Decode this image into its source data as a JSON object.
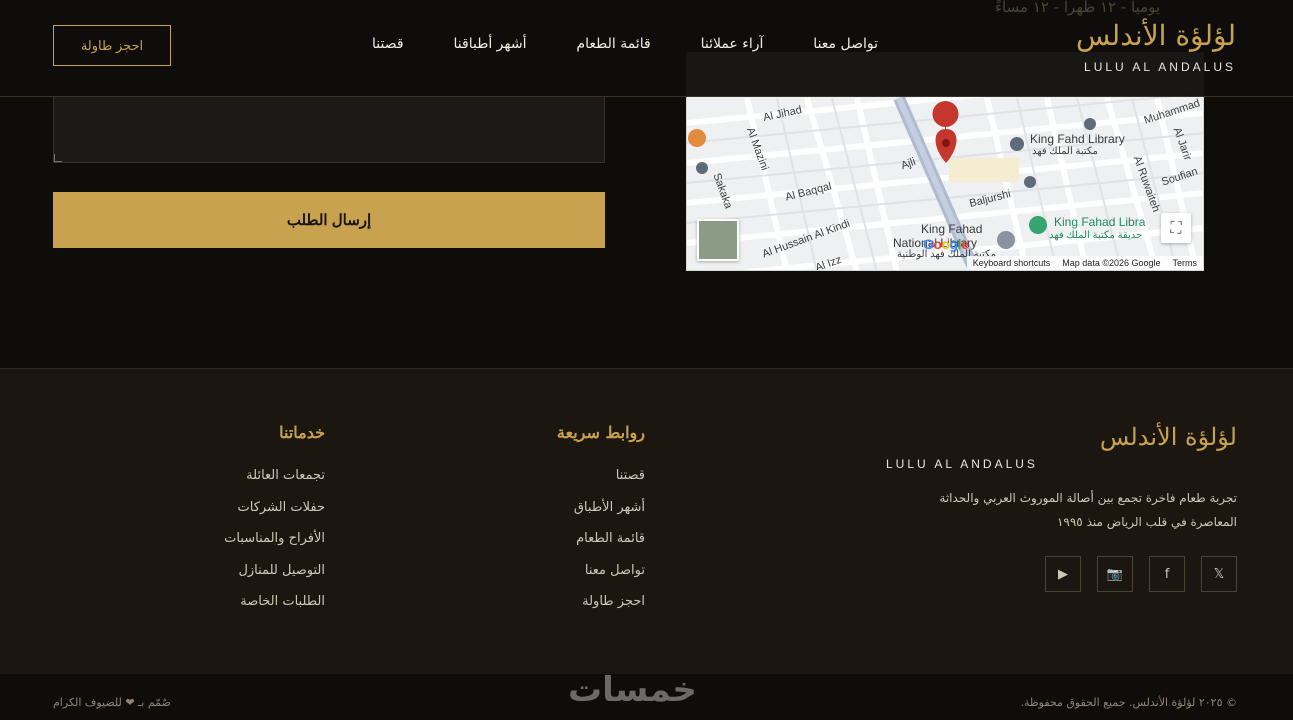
{
  "header": {
    "brand_ar": "لؤلؤة الأندلس",
    "brand_en": "LULU AL ANDALUS",
    "nav": [
      "قصتنا",
      "أشهر أطباقنا",
      "قائمة الطعام",
      "آراء عملائنا",
      "تواصل معنا"
    ],
    "reserve": "احجز طاولة",
    "ghost_text": "يومياً - ١٢ ظهراً - ١٢ مساءً"
  },
  "contact": {
    "send": "إرسال الطلب"
  },
  "map": {
    "labels": {
      "al_jihad": "Al Jihad",
      "al_mazini": "Al Mazini",
      "sakaka": "Sakaka",
      "al_baqqal": "Al Baqqal",
      "al_hussain": "Al Hussain Al Kindi",
      "ajli": "Ajli",
      "baljurshi": "Baljurshi",
      "king_fahd_library": "King Fahd Library",
      "king_fahd_library_ar": "مكتبة الملك فهد",
      "king_fahad_libra": "King Fahad Libra",
      "park_ar": "حديقة مكتبة الملك فهد",
      "king_fahad": "King Fahad",
      "national_library": "National Library",
      "national_ar": "مكتبة الملك فهد الوطنية",
      "al_ruwaiteh": "Al Ruwaiteh",
      "soufian": "Soufian",
      "al_jarir": "Al Jarir",
      "muhammad": "Muhammad",
      "al_izz": "Al Izz"
    },
    "footer": [
      "Keyboard shortcuts",
      "Map data ©2026 Google",
      "Terms"
    ],
    "google": "Google"
  },
  "footer": {
    "brand_ar": "لؤلؤة الأندلس",
    "brand_en": "LULU AL ANDALUS",
    "desc": "تجربة طعام فاخرة تجمع بين أصالة الموروث العربي والحداثة المعاصرة في قلب الرياض منذ ١٩٩٥",
    "socials": [
      "𝕏",
      "f",
      "📷",
      "▶"
    ],
    "links_title": "روابط سريعة",
    "links": [
      "قصتنا",
      "أشهر الأطباق",
      "قائمة الطعام",
      "تواصل معنا",
      "احجز طاولة"
    ],
    "services_title": "خدماتنا",
    "services": [
      "تجمعات العائلة",
      "حفلات الشركات",
      "الأفراح والمناسبات",
      "التوصيل للمنازل",
      "الطلبات الخاصة"
    ],
    "copyright": "© ٢٠٢٥ لؤلؤة الأندلس. جميع الحقوق محفوظة.",
    "made": "صُمّم بـ ❤ للضيوف الكرام",
    "watermark": "خمسات"
  },
  "colors": {
    "gold": "#c9a24f",
    "background": "#0f0d0a",
    "footer_bg": "#1b1710"
  }
}
